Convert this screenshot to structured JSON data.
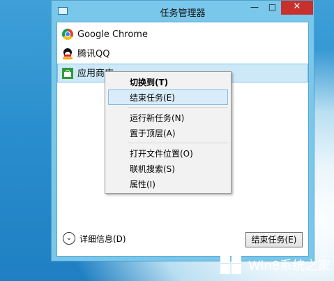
{
  "window": {
    "title": "任务管理器",
    "controls": {
      "minimize": "—",
      "maximize": "□",
      "close": "✕"
    }
  },
  "tasks": [
    {
      "label": "Google Chrome",
      "icon": "chrome-icon",
      "selected": false
    },
    {
      "label": "腾讯QQ",
      "icon": "qq-penguin-icon",
      "selected": false
    },
    {
      "label": "应用商店",
      "icon": "store-icon",
      "selected": true
    }
  ],
  "context_menu": {
    "groups": [
      [
        {
          "label": "切换到(T)",
          "bold": true
        },
        {
          "label": "结束任务(E)",
          "highlighted": true
        }
      ],
      [
        {
          "label": "运行新任务(N)"
        },
        {
          "label": "置于顶层(A)"
        }
      ],
      [
        {
          "label": "打开文件位置(O)"
        },
        {
          "label": "联机搜索(S)"
        },
        {
          "label": "属性(I)"
        }
      ]
    ]
  },
  "footer": {
    "details_label": "详细信息(D)",
    "details_icon": "chevron-down-circle-icon",
    "end_task_label": "结束任务(E)"
  },
  "watermark": {
    "text": "Win8系统之家",
    "icon": "windows-logo-icon"
  }
}
